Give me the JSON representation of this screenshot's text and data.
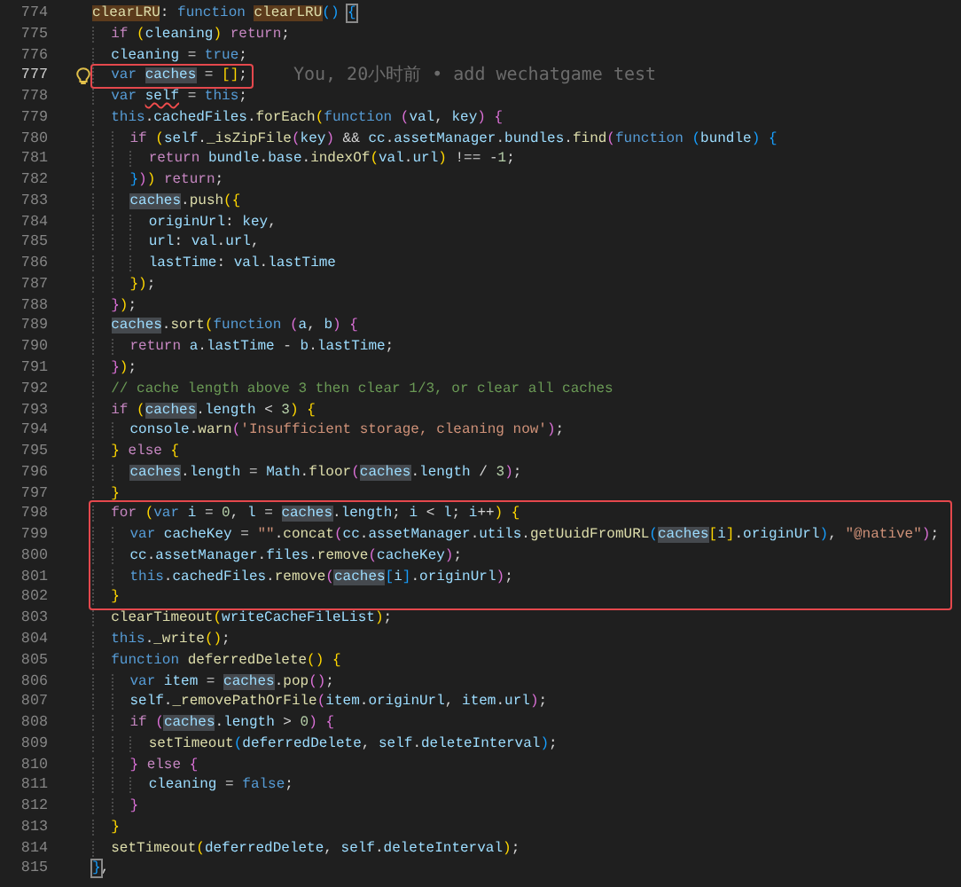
{
  "editor": {
    "lines": [
      {
        "number": "774",
        "current": false,
        "boxed": false,
        "tokens": [
          {
            "kind": "fnmatch",
            "text": "clearLRU"
          },
          {
            "kind": "plain",
            "text": ": "
          },
          {
            "kind": "keyword",
            "text": "function "
          },
          {
            "kind": "fnmatch",
            "text": "clearLRU"
          },
          {
            "kind": "bracket3",
            "text": "() "
          },
          {
            "kind": "bracematch",
            "text": "{"
          }
        ]
      },
      {
        "number": "775",
        "current": false,
        "boxed": false,
        "tokens": [
          {
            "kind": "control",
            "text": "  if "
          },
          {
            "kind": "bracket1",
            "text": "("
          },
          {
            "kind": "variable",
            "text": "cleaning"
          },
          {
            "kind": "bracket1",
            "text": ") "
          },
          {
            "kind": "control",
            "text": "return"
          },
          {
            "kind": "plain",
            "text": ";"
          }
        ]
      },
      {
        "number": "776",
        "current": false,
        "boxed": false,
        "tokens": [
          {
            "kind": "variable",
            "text": "  cleaning"
          },
          {
            "kind": "plain",
            "text": " = "
          },
          {
            "kind": "keyword",
            "text": "true"
          },
          {
            "kind": "plain",
            "text": ";"
          }
        ]
      },
      {
        "number": "777",
        "current": true,
        "boxed": true,
        "blame": "You, 20小时前 • add wechatgame test",
        "tokens": [
          {
            "kind": "keyword",
            "text": "  var "
          },
          {
            "kind": "varmatch",
            "text": "caches"
          },
          {
            "kind": "plain",
            "text": " = "
          },
          {
            "kind": "bracket1",
            "text": "[]"
          },
          {
            "kind": "plain",
            "text": ";"
          }
        ]
      },
      {
        "number": "778",
        "current": false,
        "boxed": false,
        "tokens": [
          {
            "kind": "keyword",
            "text": "  var "
          },
          {
            "kind": "error",
            "text": "self"
          },
          {
            "kind": "plain",
            "text": " = "
          },
          {
            "kind": "keyword",
            "text": "this"
          },
          {
            "kind": "plain",
            "text": ";"
          }
        ]
      },
      {
        "number": "779",
        "current": false,
        "boxed": false,
        "tokens": [
          {
            "kind": "keyword",
            "text": "  this"
          },
          {
            "kind": "plain",
            "text": "."
          },
          {
            "kind": "variable",
            "text": "cachedFiles"
          },
          {
            "kind": "plain",
            "text": "."
          },
          {
            "kind": "function",
            "text": "forEach"
          },
          {
            "kind": "bracket1",
            "text": "("
          },
          {
            "kind": "keyword",
            "text": "function "
          },
          {
            "kind": "bracket2",
            "text": "("
          },
          {
            "kind": "variable",
            "text": "val"
          },
          {
            "kind": "plain",
            "text": ", "
          },
          {
            "kind": "variable",
            "text": "key"
          },
          {
            "kind": "bracket2",
            "text": ") "
          },
          {
            "kind": "bracket2",
            "text": "{"
          }
        ]
      },
      {
        "number": "780",
        "current": false,
        "boxed": false,
        "tokens": [
          {
            "kind": "control",
            "text": "    if "
          },
          {
            "kind": "bracket1",
            "text": "("
          },
          {
            "kind": "variable",
            "text": "self"
          },
          {
            "kind": "plain",
            "text": "."
          },
          {
            "kind": "function",
            "text": "_isZipFile"
          },
          {
            "kind": "bracket2",
            "text": "("
          },
          {
            "kind": "variable",
            "text": "key"
          },
          {
            "kind": "bracket2",
            "text": ")"
          },
          {
            "kind": "plain",
            "text": " && "
          },
          {
            "kind": "variable",
            "text": "cc"
          },
          {
            "kind": "plain",
            "text": "."
          },
          {
            "kind": "variable",
            "text": "assetManager"
          },
          {
            "kind": "plain",
            "text": "."
          },
          {
            "kind": "variable",
            "text": "bundles"
          },
          {
            "kind": "plain",
            "text": "."
          },
          {
            "kind": "function",
            "text": "find"
          },
          {
            "kind": "bracket2",
            "text": "("
          },
          {
            "kind": "keyword",
            "text": "function "
          },
          {
            "kind": "bracket3",
            "text": "("
          },
          {
            "kind": "variable",
            "text": "bundle"
          },
          {
            "kind": "bracket3",
            "text": ") "
          },
          {
            "kind": "bracket3",
            "text": "{"
          }
        ]
      },
      {
        "number": "781",
        "current": false,
        "boxed": false,
        "tokens": [
          {
            "kind": "control",
            "text": "      return "
          },
          {
            "kind": "variable",
            "text": "bundle"
          },
          {
            "kind": "plain",
            "text": "."
          },
          {
            "kind": "variable",
            "text": "base"
          },
          {
            "kind": "plain",
            "text": "."
          },
          {
            "kind": "function",
            "text": "indexOf"
          },
          {
            "kind": "bracket1",
            "text": "("
          },
          {
            "kind": "variable",
            "text": "val"
          },
          {
            "kind": "plain",
            "text": "."
          },
          {
            "kind": "variable",
            "text": "url"
          },
          {
            "kind": "bracket1",
            "text": ")"
          },
          {
            "kind": "plain",
            "text": " !== -"
          },
          {
            "kind": "number",
            "text": "1"
          },
          {
            "kind": "plain",
            "text": ";"
          }
        ]
      },
      {
        "number": "782",
        "current": false,
        "boxed": false,
        "tokens": [
          {
            "kind": "bracket3",
            "text": "    }"
          },
          {
            "kind": "bracket2",
            "text": ")"
          },
          {
            "kind": "bracket1",
            "text": ") "
          },
          {
            "kind": "control",
            "text": "return"
          },
          {
            "kind": "plain",
            "text": ";"
          }
        ]
      },
      {
        "number": "783",
        "current": false,
        "boxed": false,
        "tokens": [
          {
            "kind": "varmatch",
            "text": "    caches"
          },
          {
            "kind": "plain",
            "text": "."
          },
          {
            "kind": "function",
            "text": "push"
          },
          {
            "kind": "bracket1",
            "text": "("
          },
          {
            "kind": "bracket1",
            "text": "{"
          }
        ]
      },
      {
        "number": "784",
        "current": false,
        "boxed": false,
        "tokens": [
          {
            "kind": "variable",
            "text": "      originUrl"
          },
          {
            "kind": "plain",
            "text": ": "
          },
          {
            "kind": "variable",
            "text": "key"
          },
          {
            "kind": "plain",
            "text": ","
          }
        ]
      },
      {
        "number": "785",
        "current": false,
        "boxed": false,
        "tokens": [
          {
            "kind": "variable",
            "text": "      url"
          },
          {
            "kind": "plain",
            "text": ": "
          },
          {
            "kind": "variable",
            "text": "val"
          },
          {
            "kind": "plain",
            "text": "."
          },
          {
            "kind": "variable",
            "text": "url"
          },
          {
            "kind": "plain",
            "text": ","
          }
        ]
      },
      {
        "number": "786",
        "current": false,
        "boxed": false,
        "tokens": [
          {
            "kind": "variable",
            "text": "      lastTime"
          },
          {
            "kind": "plain",
            "text": ": "
          },
          {
            "kind": "variable",
            "text": "val"
          },
          {
            "kind": "plain",
            "text": "."
          },
          {
            "kind": "variable",
            "text": "lastTime"
          }
        ]
      },
      {
        "number": "787",
        "current": false,
        "boxed": false,
        "tokens": [
          {
            "kind": "bracket1",
            "text": "    }"
          },
          {
            "kind": "bracket1",
            "text": ")"
          },
          {
            "kind": "plain",
            "text": ";"
          }
        ]
      },
      {
        "number": "788",
        "current": false,
        "boxed": false,
        "tokens": [
          {
            "kind": "bracket2",
            "text": "  }"
          },
          {
            "kind": "bracket1",
            "text": ")"
          },
          {
            "kind": "plain",
            "text": ";"
          }
        ]
      },
      {
        "number": "789",
        "current": false,
        "boxed": false,
        "tokens": [
          {
            "kind": "varmatch",
            "text": "  caches"
          },
          {
            "kind": "plain",
            "text": "."
          },
          {
            "kind": "function",
            "text": "sort"
          },
          {
            "kind": "bracket1",
            "text": "("
          },
          {
            "kind": "keyword",
            "text": "function "
          },
          {
            "kind": "bracket2",
            "text": "("
          },
          {
            "kind": "variable",
            "text": "a"
          },
          {
            "kind": "plain",
            "text": ", "
          },
          {
            "kind": "variable",
            "text": "b"
          },
          {
            "kind": "bracket2",
            "text": ") "
          },
          {
            "kind": "bracket2",
            "text": "{"
          }
        ]
      },
      {
        "number": "790",
        "current": false,
        "boxed": false,
        "tokens": [
          {
            "kind": "control",
            "text": "    return "
          },
          {
            "kind": "variable",
            "text": "a"
          },
          {
            "kind": "plain",
            "text": "."
          },
          {
            "kind": "variable",
            "text": "lastTime"
          },
          {
            "kind": "plain",
            "text": " - "
          },
          {
            "kind": "variable",
            "text": "b"
          },
          {
            "kind": "plain",
            "text": "."
          },
          {
            "kind": "variable",
            "text": "lastTime"
          },
          {
            "kind": "plain",
            "text": ";"
          }
        ]
      },
      {
        "number": "791",
        "current": false,
        "boxed": false,
        "tokens": [
          {
            "kind": "bracket2",
            "text": "  }"
          },
          {
            "kind": "bracket1",
            "text": ")"
          },
          {
            "kind": "plain",
            "text": ";"
          }
        ]
      },
      {
        "number": "792",
        "current": false,
        "boxed": false,
        "tokens": [
          {
            "kind": "comment",
            "text": "  // cache length above 3 then clear 1/3, or clear all caches"
          }
        ]
      },
      {
        "number": "793",
        "current": false,
        "boxed": false,
        "tokens": [
          {
            "kind": "control",
            "text": "  if "
          },
          {
            "kind": "bracket1",
            "text": "("
          },
          {
            "kind": "varmatch",
            "text": "caches"
          },
          {
            "kind": "plain",
            "text": "."
          },
          {
            "kind": "variable",
            "text": "length"
          },
          {
            "kind": "plain",
            "text": " < "
          },
          {
            "kind": "number",
            "text": "3"
          },
          {
            "kind": "bracket1",
            "text": ") "
          },
          {
            "kind": "bracket1",
            "text": "{"
          }
        ]
      },
      {
        "number": "794",
        "current": false,
        "boxed": false,
        "tokens": [
          {
            "kind": "variable",
            "text": "    console"
          },
          {
            "kind": "plain",
            "text": "."
          },
          {
            "kind": "function",
            "text": "warn"
          },
          {
            "kind": "bracket2",
            "text": "("
          },
          {
            "kind": "string",
            "text": "'Insufficient storage, cleaning now'"
          },
          {
            "kind": "bracket2",
            "text": ")"
          },
          {
            "kind": "plain",
            "text": ";"
          }
        ]
      },
      {
        "number": "795",
        "current": false,
        "boxed": false,
        "tokens": [
          {
            "kind": "bracket1",
            "text": "  } "
          },
          {
            "kind": "control",
            "text": "else "
          },
          {
            "kind": "bracket1",
            "text": "{"
          }
        ]
      },
      {
        "number": "796",
        "current": false,
        "boxed": false,
        "tokens": [
          {
            "kind": "varmatch",
            "text": "    caches"
          },
          {
            "kind": "plain",
            "text": "."
          },
          {
            "kind": "variable",
            "text": "length"
          },
          {
            "kind": "plain",
            "text": " = "
          },
          {
            "kind": "variable",
            "text": "Math"
          },
          {
            "kind": "plain",
            "text": "."
          },
          {
            "kind": "function",
            "text": "floor"
          },
          {
            "kind": "bracket2",
            "text": "("
          },
          {
            "kind": "varmatch",
            "text": "caches"
          },
          {
            "kind": "plain",
            "text": "."
          },
          {
            "kind": "variable",
            "text": "length"
          },
          {
            "kind": "plain",
            "text": " / "
          },
          {
            "kind": "number",
            "text": "3"
          },
          {
            "kind": "bracket2",
            "text": ")"
          },
          {
            "kind": "plain",
            "text": ";"
          }
        ]
      },
      {
        "number": "797",
        "current": false,
        "boxed": false,
        "tokens": [
          {
            "kind": "bracket1",
            "text": "  }"
          }
        ]
      },
      {
        "number": "798",
        "current": false,
        "boxed": true,
        "tokens": [
          {
            "kind": "control",
            "text": "  for "
          },
          {
            "kind": "bracket1",
            "text": "("
          },
          {
            "kind": "keyword",
            "text": "var "
          },
          {
            "kind": "variable",
            "text": "i"
          },
          {
            "kind": "plain",
            "text": " = "
          },
          {
            "kind": "number",
            "text": "0"
          },
          {
            "kind": "plain",
            "text": ", "
          },
          {
            "kind": "variable",
            "text": "l"
          },
          {
            "kind": "plain",
            "text": " = "
          },
          {
            "kind": "varmatch",
            "text": "caches"
          },
          {
            "kind": "plain",
            "text": "."
          },
          {
            "kind": "variable",
            "text": "length"
          },
          {
            "kind": "plain",
            "text": "; "
          },
          {
            "kind": "variable",
            "text": "i"
          },
          {
            "kind": "plain",
            "text": " < "
          },
          {
            "kind": "variable",
            "text": "l"
          },
          {
            "kind": "plain",
            "text": "; "
          },
          {
            "kind": "variable",
            "text": "i"
          },
          {
            "kind": "plain",
            "text": "++"
          },
          {
            "kind": "bracket1",
            "text": ") "
          },
          {
            "kind": "bracket1",
            "text": "{"
          }
        ]
      },
      {
        "number": "799",
        "current": false,
        "boxed": true,
        "tokens": [
          {
            "kind": "keyword",
            "text": "    var "
          },
          {
            "kind": "variable",
            "text": "cacheKey"
          },
          {
            "kind": "plain",
            "text": " = "
          },
          {
            "kind": "string",
            "text": "\"\""
          },
          {
            "kind": "plain",
            "text": "."
          },
          {
            "kind": "function",
            "text": "concat"
          },
          {
            "kind": "bracket2",
            "text": "("
          },
          {
            "kind": "variable",
            "text": "cc"
          },
          {
            "kind": "plain",
            "text": "."
          },
          {
            "kind": "variable",
            "text": "assetManager"
          },
          {
            "kind": "plain",
            "text": "."
          },
          {
            "kind": "variable",
            "text": "utils"
          },
          {
            "kind": "plain",
            "text": "."
          },
          {
            "kind": "function",
            "text": "getUuidFromURL"
          },
          {
            "kind": "bracket3",
            "text": "("
          },
          {
            "kind": "varmatch",
            "text": "caches"
          },
          {
            "kind": "bracket1",
            "text": "["
          },
          {
            "kind": "variable",
            "text": "i"
          },
          {
            "kind": "bracket1",
            "text": "]"
          },
          {
            "kind": "plain",
            "text": "."
          },
          {
            "kind": "variable",
            "text": "originUrl"
          },
          {
            "kind": "bracket3",
            "text": ")"
          },
          {
            "kind": "plain",
            "text": ", "
          },
          {
            "kind": "string",
            "text": "\"@native\""
          },
          {
            "kind": "bracket2",
            "text": ")"
          },
          {
            "kind": "plain",
            "text": ";"
          }
        ]
      },
      {
        "number": "800",
        "current": false,
        "boxed": true,
        "tokens": [
          {
            "kind": "variable",
            "text": "    cc"
          },
          {
            "kind": "plain",
            "text": "."
          },
          {
            "kind": "variable",
            "text": "assetManager"
          },
          {
            "kind": "plain",
            "text": "."
          },
          {
            "kind": "variable",
            "text": "files"
          },
          {
            "kind": "plain",
            "text": "."
          },
          {
            "kind": "function",
            "text": "remove"
          },
          {
            "kind": "bracket2",
            "text": "("
          },
          {
            "kind": "variable",
            "text": "cacheKey"
          },
          {
            "kind": "bracket2",
            "text": ")"
          },
          {
            "kind": "plain",
            "text": ";"
          }
        ]
      },
      {
        "number": "801",
        "current": false,
        "boxed": true,
        "tokens": [
          {
            "kind": "keyword",
            "text": "    this"
          },
          {
            "kind": "plain",
            "text": "."
          },
          {
            "kind": "variable",
            "text": "cachedFiles"
          },
          {
            "kind": "plain",
            "text": "."
          },
          {
            "kind": "function",
            "text": "remove"
          },
          {
            "kind": "bracket2",
            "text": "("
          },
          {
            "kind": "varmatch",
            "text": "caches"
          },
          {
            "kind": "bracket3",
            "text": "["
          },
          {
            "kind": "variable",
            "text": "i"
          },
          {
            "kind": "bracket3",
            "text": "]"
          },
          {
            "kind": "plain",
            "text": "."
          },
          {
            "kind": "variable",
            "text": "originUrl"
          },
          {
            "kind": "bracket2",
            "text": ")"
          },
          {
            "kind": "plain",
            "text": ";"
          }
        ]
      },
      {
        "number": "802",
        "current": false,
        "boxed": true,
        "tokens": [
          {
            "kind": "bracket1",
            "text": "  }"
          }
        ]
      },
      {
        "number": "803",
        "current": false,
        "boxed": false,
        "tokens": [
          {
            "kind": "function",
            "text": "  clearTimeout"
          },
          {
            "kind": "bracket1",
            "text": "("
          },
          {
            "kind": "variable",
            "text": "writeCacheFileList"
          },
          {
            "kind": "bracket1",
            "text": ")"
          },
          {
            "kind": "plain",
            "text": ";"
          }
        ]
      },
      {
        "number": "804",
        "current": false,
        "boxed": false,
        "tokens": [
          {
            "kind": "keyword",
            "text": "  this"
          },
          {
            "kind": "plain",
            "text": "."
          },
          {
            "kind": "function",
            "text": "_write"
          },
          {
            "kind": "bracket1",
            "text": "()"
          },
          {
            "kind": "plain",
            "text": ";"
          }
        ]
      },
      {
        "number": "805",
        "current": false,
        "boxed": false,
        "tokens": [
          {
            "kind": "keyword",
            "text": "  function "
          },
          {
            "kind": "function",
            "text": "deferredDelete"
          },
          {
            "kind": "bracket1",
            "text": "() "
          },
          {
            "kind": "bracket1",
            "text": "{"
          }
        ]
      },
      {
        "number": "806",
        "current": false,
        "boxed": false,
        "tokens": [
          {
            "kind": "keyword",
            "text": "    var "
          },
          {
            "kind": "variable",
            "text": "item"
          },
          {
            "kind": "plain",
            "text": " = "
          },
          {
            "kind": "varmatch",
            "text": "caches"
          },
          {
            "kind": "plain",
            "text": "."
          },
          {
            "kind": "function",
            "text": "pop"
          },
          {
            "kind": "bracket2",
            "text": "()"
          },
          {
            "kind": "plain",
            "text": ";"
          }
        ]
      },
      {
        "number": "807",
        "current": false,
        "boxed": false,
        "tokens": [
          {
            "kind": "variable",
            "text": "    self"
          },
          {
            "kind": "plain",
            "text": "."
          },
          {
            "kind": "function",
            "text": "_removePathOrFile"
          },
          {
            "kind": "bracket2",
            "text": "("
          },
          {
            "kind": "variable",
            "text": "item"
          },
          {
            "kind": "plain",
            "text": "."
          },
          {
            "kind": "variable",
            "text": "originUrl"
          },
          {
            "kind": "plain",
            "text": ", "
          },
          {
            "kind": "variable",
            "text": "item"
          },
          {
            "kind": "plain",
            "text": "."
          },
          {
            "kind": "variable",
            "text": "url"
          },
          {
            "kind": "bracket2",
            "text": ")"
          },
          {
            "kind": "plain",
            "text": ";"
          }
        ]
      },
      {
        "number": "808",
        "current": false,
        "boxed": false,
        "tokens": [
          {
            "kind": "control",
            "text": "    if "
          },
          {
            "kind": "bracket2",
            "text": "("
          },
          {
            "kind": "varmatch",
            "text": "caches"
          },
          {
            "kind": "plain",
            "text": "."
          },
          {
            "kind": "variable",
            "text": "length"
          },
          {
            "kind": "plain",
            "text": " > "
          },
          {
            "kind": "number",
            "text": "0"
          },
          {
            "kind": "bracket2",
            "text": ") "
          },
          {
            "kind": "bracket2",
            "text": "{"
          }
        ]
      },
      {
        "number": "809",
        "current": false,
        "boxed": false,
        "tokens": [
          {
            "kind": "function",
            "text": "      setTimeout"
          },
          {
            "kind": "bracket3",
            "text": "("
          },
          {
            "kind": "variable",
            "text": "deferredDelete"
          },
          {
            "kind": "plain",
            "text": ", "
          },
          {
            "kind": "variable",
            "text": "self"
          },
          {
            "kind": "plain",
            "text": "."
          },
          {
            "kind": "variable",
            "text": "deleteInterval"
          },
          {
            "kind": "bracket3",
            "text": ")"
          },
          {
            "kind": "plain",
            "text": ";"
          }
        ]
      },
      {
        "number": "810",
        "current": false,
        "boxed": false,
        "tokens": [
          {
            "kind": "bracket2",
            "text": "    } "
          },
          {
            "kind": "control",
            "text": "else "
          },
          {
            "kind": "bracket2",
            "text": "{"
          }
        ]
      },
      {
        "number": "811",
        "current": false,
        "boxed": false,
        "tokens": [
          {
            "kind": "variable",
            "text": "      cleaning"
          },
          {
            "kind": "plain",
            "text": " = "
          },
          {
            "kind": "keyword",
            "text": "false"
          },
          {
            "kind": "plain",
            "text": ";"
          }
        ]
      },
      {
        "number": "812",
        "current": false,
        "boxed": false,
        "tokens": [
          {
            "kind": "bracket2",
            "text": "    }"
          }
        ]
      },
      {
        "number": "813",
        "current": false,
        "boxed": false,
        "tokens": [
          {
            "kind": "bracket1",
            "text": "  }"
          }
        ]
      },
      {
        "number": "814",
        "current": false,
        "boxed": false,
        "tokens": [
          {
            "kind": "function",
            "text": "  setTimeout"
          },
          {
            "kind": "bracket1",
            "text": "("
          },
          {
            "kind": "variable",
            "text": "deferredDelete"
          },
          {
            "kind": "plain",
            "text": ", "
          },
          {
            "kind": "variable",
            "text": "self"
          },
          {
            "kind": "plain",
            "text": "."
          },
          {
            "kind": "variable",
            "text": "deleteInterval"
          },
          {
            "kind": "bracket1",
            "text": ")"
          },
          {
            "kind": "plain",
            "text": ";"
          }
        ]
      },
      {
        "number": "815",
        "current": false,
        "boxed": false,
        "tokens": [
          {
            "kind": "bracematch",
            "text": "}"
          },
          {
            "kind": "plain",
            "text": ","
          }
        ]
      }
    ]
  }
}
